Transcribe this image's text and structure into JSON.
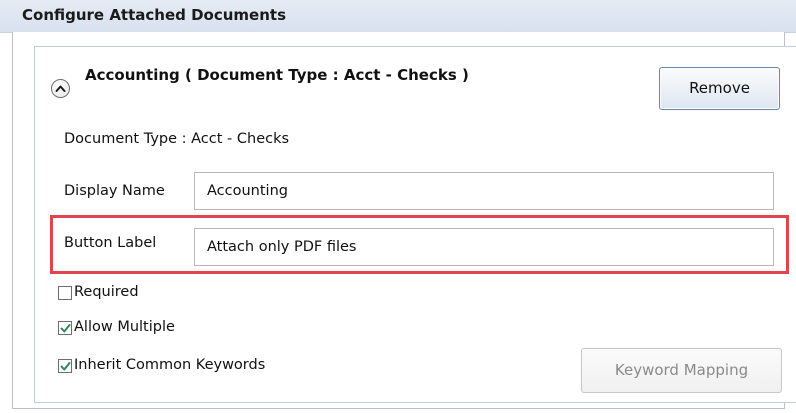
{
  "header": {
    "title": "Configure Attached Documents"
  },
  "section": {
    "title": "Accounting  ( Document Type : Acct - Checks )",
    "collapse_icon": "chevron-up-circle-icon",
    "remove_label": "Remove",
    "document_type_text": "Document Type : Acct - Checks"
  },
  "fields": {
    "display_name_label": "Display Name",
    "display_name_value": "Accounting",
    "button_label_label": "Button Label",
    "button_label_value": "Attach only PDF files"
  },
  "options": {
    "required_label": "Required",
    "required_checked": false,
    "allow_multiple_label": "Allow Multiple",
    "allow_multiple_checked": true,
    "inherit_keywords_label": "Inherit Common Keywords",
    "inherit_keywords_checked": true
  },
  "keyword_mapping": {
    "label": "Keyword Mapping",
    "enabled": false
  },
  "colors": {
    "highlight": "#e0444d",
    "checkmark": "#2e8b57",
    "header_bg": "#dbe4f0"
  }
}
